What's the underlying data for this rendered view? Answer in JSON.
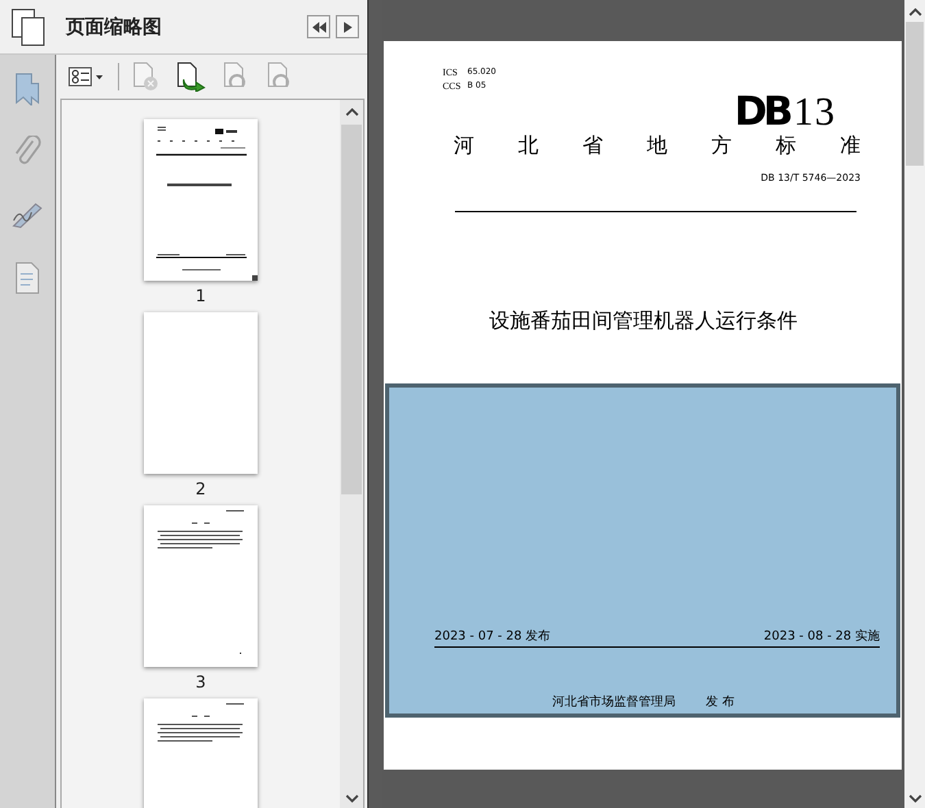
{
  "panel": {
    "title": "页面缩略图"
  },
  "side_tabs": [
    {
      "kind": "bookmark",
      "selected": true
    },
    {
      "kind": "clip",
      "selected": false
    },
    {
      "kind": "sign",
      "selected": false
    },
    {
      "kind": "page",
      "selected": false
    }
  ],
  "toolbar": [
    {
      "kind": "delete",
      "disabled": true
    },
    {
      "kind": "insert",
      "disabled": false
    },
    {
      "kind": "undo",
      "disabled": true
    },
    {
      "kind": "redo",
      "disabled": true
    }
  ],
  "thumbnails": [
    {
      "kind": "cover",
      "label": "1"
    },
    {
      "kind": "blank",
      "label": "2"
    },
    {
      "kind": "text",
      "label": "3"
    },
    {
      "kind": "text"
    }
  ],
  "document": {
    "ics_label": "ICS",
    "ics": "65.020",
    "ccs_label": "CCS",
    "ccs": "B 05",
    "logo": "**DB**13",
    "category": "河北省地方标准",
    "number": "DB 13/T 5746—2023",
    "title": "设施番茄田间管理机器人运行条件",
    "issued": "2023 - 07 - 28 发布",
    "effective": "2023 - 08 - 28 实施",
    "issuer": "河北省市场监督管理局",
    "issuer_action": "发 布"
  }
}
